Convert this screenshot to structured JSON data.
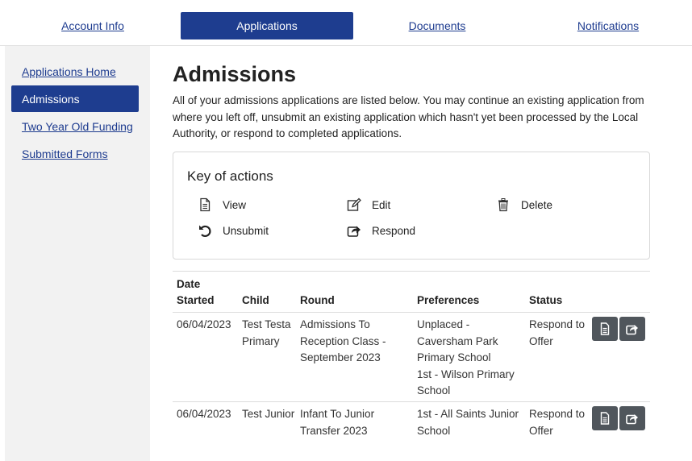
{
  "topnav": {
    "tabs": [
      {
        "label": "Account Info",
        "active": false
      },
      {
        "label": "Applications",
        "active": true
      },
      {
        "label": "Documents",
        "active": false
      },
      {
        "label": "Notifications",
        "active": false
      }
    ]
  },
  "sidebar": {
    "items": [
      {
        "label": "Applications Home",
        "active": false
      },
      {
        "label": "Admissions",
        "active": true
      },
      {
        "label": "Two Year Old Funding",
        "active": false
      },
      {
        "label": "Submitted Forms",
        "active": false
      }
    ]
  },
  "main": {
    "title": "Admissions",
    "intro": "All of your admissions applications are listed below. You may continue an existing application from where you left off, unsubmit an existing application which hasn't yet been processed by the Local Authority, or respond to completed applications.",
    "key": {
      "title": "Key of actions",
      "items": [
        {
          "label": "View",
          "icon": "document-icon"
        },
        {
          "label": "Edit",
          "icon": "edit-icon"
        },
        {
          "label": "Delete",
          "icon": "trash-icon"
        },
        {
          "label": "Unsubmit",
          "icon": "undo-icon"
        },
        {
          "label": "Respond",
          "icon": "share-icon"
        }
      ]
    },
    "table": {
      "headers": [
        "Date\nStarted",
        "Child",
        "Round",
        "Preferences",
        "Status"
      ],
      "rows": [
        {
          "date": "06/04/2023",
          "child": "Test Testa Primary",
          "round": "Admissions To Reception Class - September 2023",
          "preferences": "Unplaced - Caversham Park Primary School\n1st - Wilson Primary School",
          "status": "Respond to Offer"
        },
        {
          "date": "06/04/2023",
          "child": "Test Junior",
          "round": "Infant To Junior Transfer 2023",
          "preferences": "1st - All Saints Junior School",
          "status": "Respond to Offer"
        }
      ]
    }
  },
  "colors": {
    "accent": "#1e3d8f",
    "link": "#1d3b8f",
    "sidebar_bg": "#f2f2f2",
    "action_button": "#50565c"
  }
}
